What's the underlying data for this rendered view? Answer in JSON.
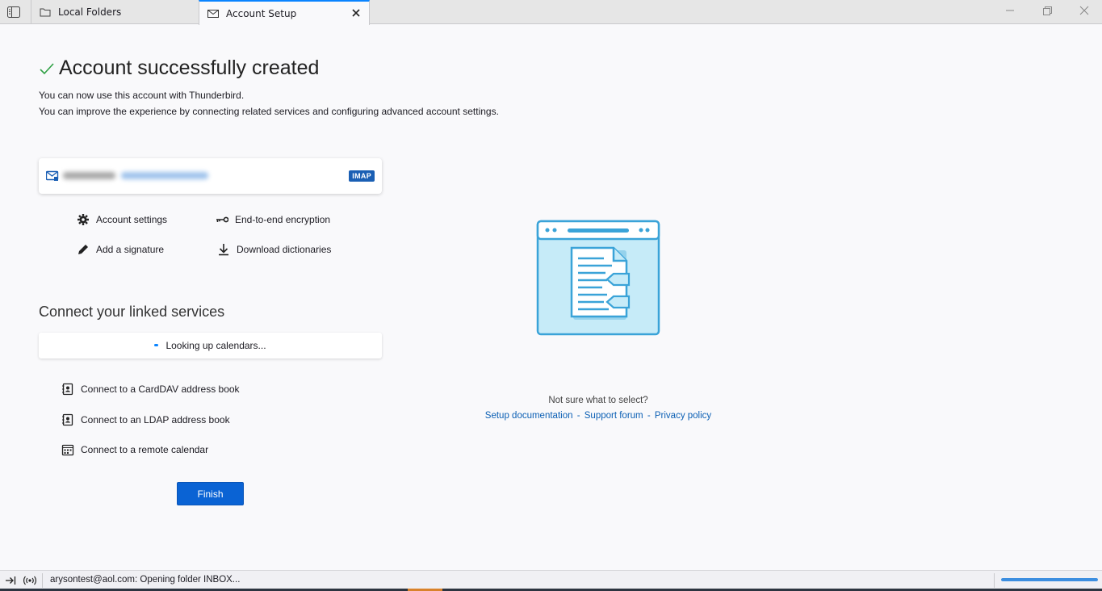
{
  "tabs": {
    "local_folders": "Local Folders",
    "account_setup": "Account Setup"
  },
  "setup": {
    "title": "Account successfully created",
    "line1": "You can now use this account with Thunderbird.",
    "line2": "You can improve the experience by connecting related services and configuring advanced account settings.",
    "account_type": "IMAP",
    "actions": {
      "account_settings": "Account settings",
      "e2e": "End-to-end encryption",
      "signature": "Add a signature",
      "dictionaries": "Download dictionaries"
    },
    "linked_title": "Connect your linked services",
    "lookup": "Looking up calendars...",
    "connect": {
      "carddav": "Connect to a CardDAV address book",
      "ldap": "Connect to an LDAP address book",
      "calendar": "Connect to a remote calendar"
    },
    "finish": "Finish"
  },
  "help": {
    "question": "Not sure what to select?",
    "docs": "Setup documentation",
    "forum": "Support forum",
    "privacy": "Privacy policy",
    "separator": "-"
  },
  "status": {
    "text": "arysontest@aol.com: Opening folder INBOX...",
    "progress": 1.0
  },
  "colors": {
    "accent": "#0a63d4",
    "check": "#2ea043",
    "illustration": "#3aa3d8"
  }
}
